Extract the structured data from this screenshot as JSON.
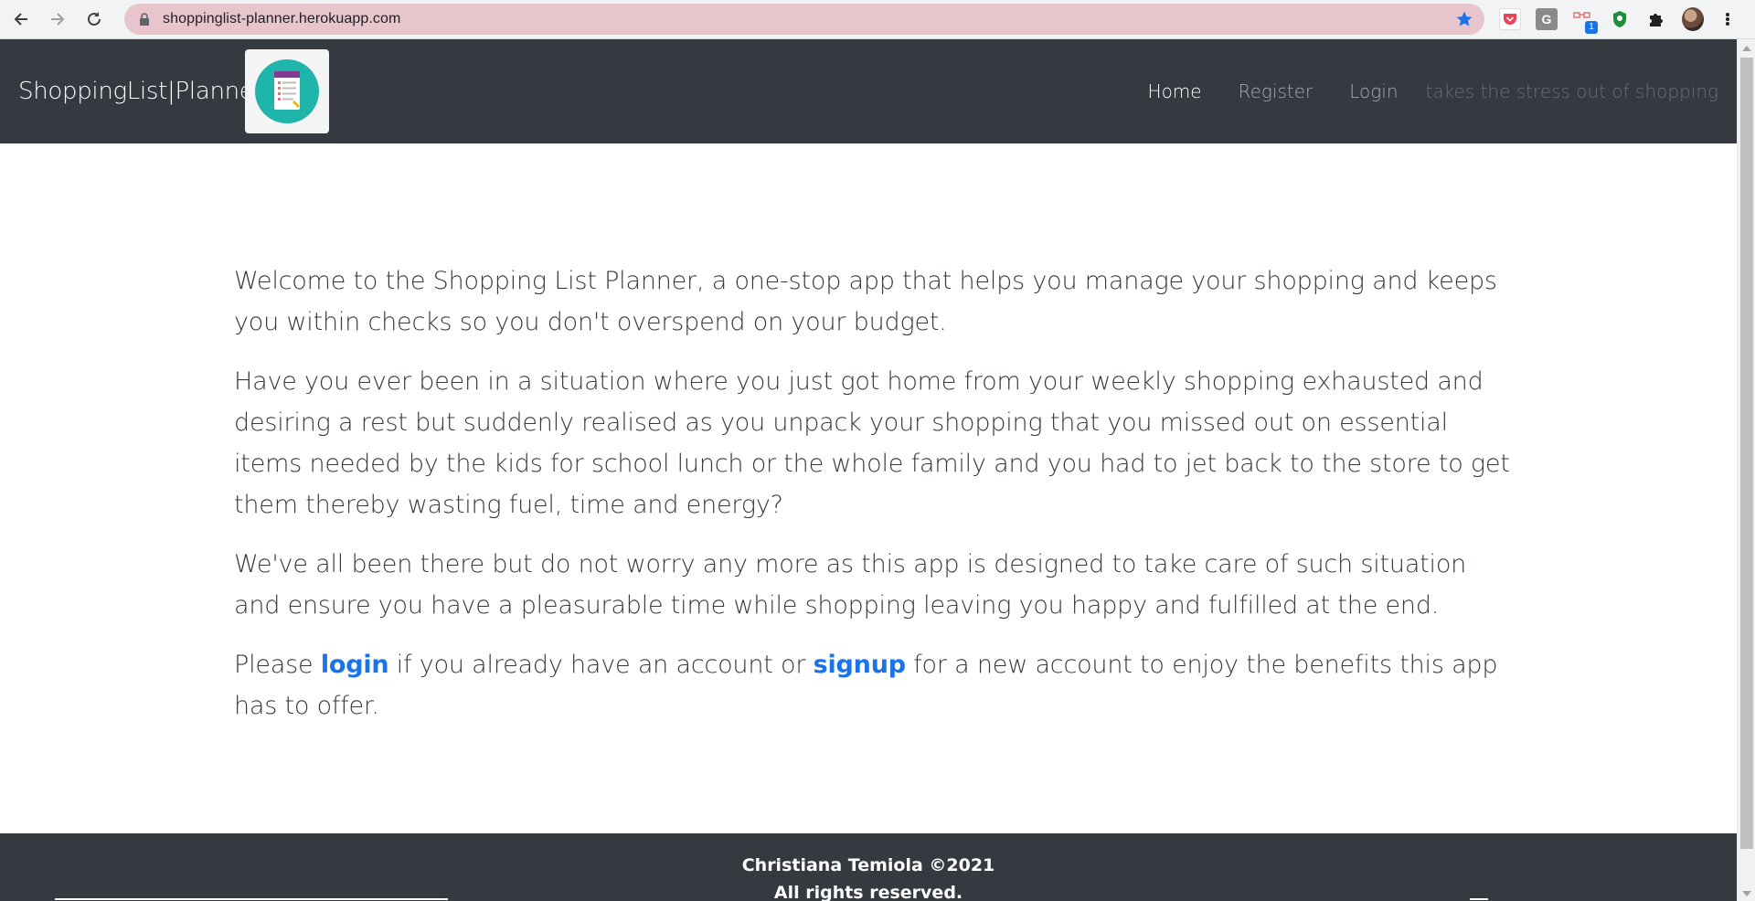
{
  "browser": {
    "url": "shoppinglist-planner.herokuapp.com",
    "extension_badge": "1",
    "ext_g_letter": "G",
    "colors": {
      "omnibox": "#e8c5cd",
      "star": "#1a73e8"
    }
  },
  "navbar": {
    "brand": "ShoppingList|Planner",
    "links": {
      "home": "Home",
      "register": "Register",
      "login": "Login"
    },
    "tagline": "takes the stress out of shopping",
    "colors": {
      "background": "#343a40",
      "logo_circle": "#1fb5ab"
    }
  },
  "main": {
    "paragraph_1": "Welcome to the Shopping List Planner, a one-stop app that helps you manage your shopping and keeps you within checks so you don't overspend on your budget.",
    "paragraph_2": "Have you ever been in a situation where you just got home from your weekly shopping exhausted and desiring a rest but suddenly realised as you unpack your shopping that you missed out on essential items needed by the kids for school lunch or the whole family and you had to jet back to the store to get them thereby wasting fuel, time and energy?",
    "paragraph_3": "We've all been there but do not worry any more as this app is designed to take care of such situation and ensure you have a pleasurable time while shopping leaving you happy and fulfilled at the end.",
    "paragraph_4": {
      "prefix": "Please ",
      "login_link": "login",
      "middle": " if you already have an account or ",
      "signup_link": "signup",
      "suffix": " for a new account to enjoy the benefits this app has to offer."
    },
    "colors": {
      "link": "#1a73e8",
      "text": "#343a40"
    }
  },
  "footer": {
    "copyright": "Christiana Temiola ©2021",
    "rights": "All rights reserved."
  }
}
